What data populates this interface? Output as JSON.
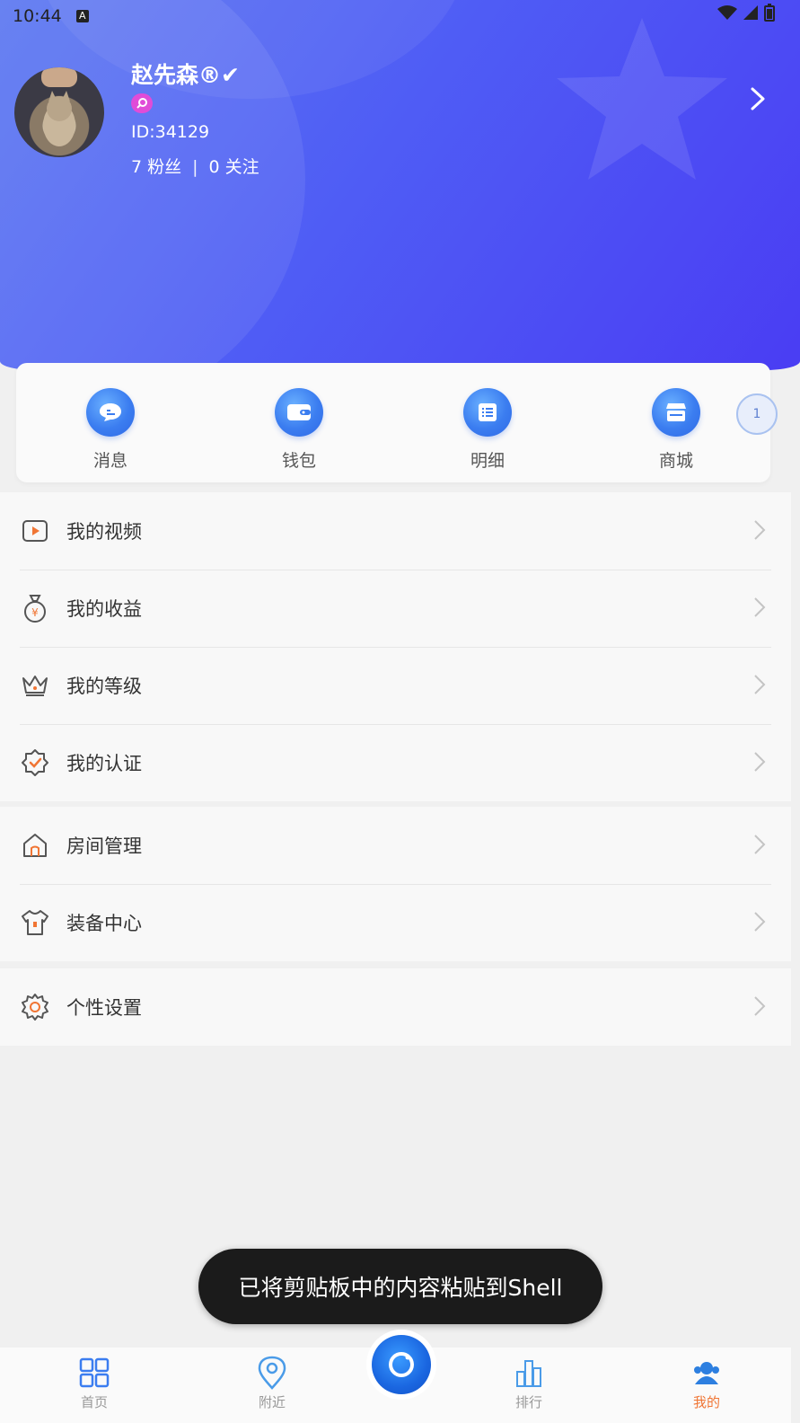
{
  "status_bar": {
    "time": "10:44",
    "notification_icon": "A"
  },
  "profile": {
    "name": "赵先森®✔",
    "id_text": "ID:34129",
    "fans": "7 粉丝",
    "separator": "|",
    "following": "0 关注",
    "badge_icon": "search-badge-icon",
    "arrow_icon": "chevron-right-icon"
  },
  "quick_actions": [
    {
      "label": "消息",
      "icon": "message-icon"
    },
    {
      "label": "钱包",
      "icon": "wallet-icon"
    },
    {
      "label": "明细",
      "icon": "list-detail-icon"
    },
    {
      "label": "商城",
      "icon": "shop-icon"
    }
  ],
  "quick_badge": "1",
  "menu_group_1": [
    {
      "label": "我的视频",
      "icon": "video-icon"
    },
    {
      "label": "我的收益",
      "icon": "money-bag-icon"
    },
    {
      "label": "我的等级",
      "icon": "crown-icon"
    },
    {
      "label": "我的认证",
      "icon": "verified-icon"
    }
  ],
  "menu_group_2": [
    {
      "label": "房间管理",
      "icon": "home-icon"
    },
    {
      "label": "装备中心",
      "icon": "tshirt-icon"
    }
  ],
  "menu_group_3": [
    {
      "label": "个性设置",
      "icon": "settings-gear-icon"
    }
  ],
  "toast": "已将剪贴板中的内容粘贴到Shell",
  "bottom_nav": {
    "home": "首页",
    "nearby": "附近",
    "rank": "排行",
    "mine": "我的"
  },
  "colors": {
    "header_gradient_start": "#5c78f0",
    "header_gradient_end": "#4a3df3",
    "accent_blue": "#3b7df0",
    "accent_orange": "#f07534"
  }
}
